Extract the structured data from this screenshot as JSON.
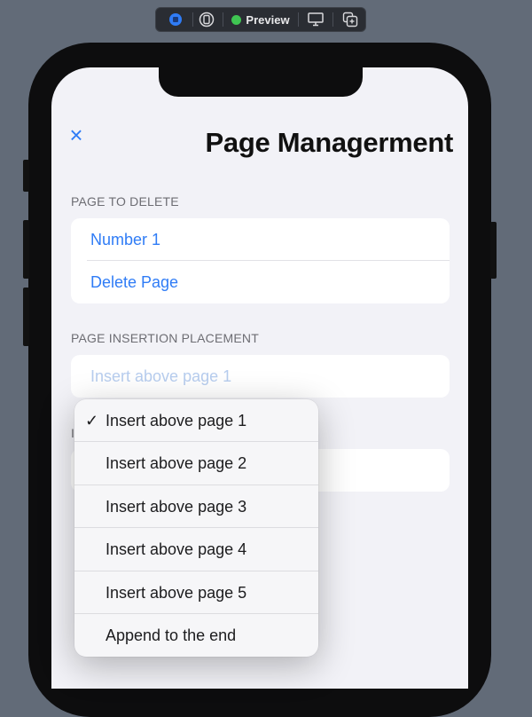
{
  "toolbar": {
    "preview_label": "Preview",
    "icons": [
      "live-preview-icon",
      "device-icon",
      "preview-status-icon",
      "display-icon",
      "duplicate-icon"
    ]
  },
  "nav": {
    "close_icon": "×",
    "title": "Page Managerment"
  },
  "delete_section": {
    "header": "PAGE TO DELETE",
    "rows": [
      "Number 1",
      "Delete Page"
    ]
  },
  "insertion_section": {
    "header": "PAGE INSERTION PLACEMENT",
    "selected": "Insert above page 1"
  },
  "menu": {
    "checkmark": "✓",
    "items": [
      "Insert above page 1",
      "Insert above page 2",
      "Insert above page 3",
      "Insert above page 4",
      "Insert above page 5",
      "Append to the end"
    ],
    "selected_index": 0
  },
  "colors": {
    "accent": "#2f7cf6",
    "background": "#f2f2f7",
    "desktop": "#626b78"
  }
}
